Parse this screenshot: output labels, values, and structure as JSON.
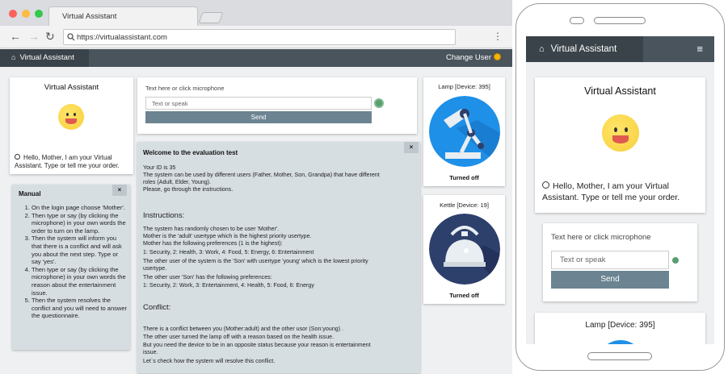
{
  "browser": {
    "tab_title": "Virtual Assistant",
    "url": "https://virtualassistant.com"
  },
  "nav": {
    "brand": "Virtual Assistant",
    "change_user": "Change User"
  },
  "assistant": {
    "title": "Virtual Assistant",
    "greeting": "Hello, Mother, I am your Virtual Assistant. Type or tell me your order.",
    "greeting_line1": "Hello, Mother, I am your Virtual",
    "greeting_line2": "Assistant. Type or tell me your order."
  },
  "input": {
    "label": "Text here or click microphone",
    "placeholder": "Text or speak",
    "send_label": "Send"
  },
  "manual": {
    "title": "Manual",
    "close": "×",
    "items": [
      "On the login page choose 'Mother'.",
      "Then type or say (by clicking the microphone) in your own words the order to turn on the lamp.",
      "Then the system will inform you that there is a conflict and will ask you about the next step. Type or say 'yes'.",
      "Then type or say (by clicking the microphone) in your own words the reason about the entertainment issue.",
      "Then the system resolves the conflict and you will need to answer the questionnaire."
    ]
  },
  "welcome": {
    "title": "Welcome to the evaluation test",
    "close": "×",
    "id_line": "Your ID is 35",
    "intro_1": "The system can be used by different users (Father, Mother, Son, Grandpa) that have different",
    "intro_2": "roles (Adult, Elder, Young).",
    "intro_3": "Please, go through the instructions.",
    "instructions_heading": "Instructions:",
    "instr_1": "The system has randomly chosen to be user 'Mother'.",
    "instr_2": "Mother is the 'adult' usertype which is the highest priority usertype.",
    "instr_3": "Mother has the following preferences (1 is the highest):",
    "instr_4": "1: Security, 2: Health, 3: Work, 4: Food, 5: Energy, 6: Entertainment",
    "instr_5": "The other user of the system is the 'Son' with usertype 'young' which is the lowest priority",
    "instr_6": "usertype.",
    "instr_7": "The other user 'Son' has the following preferences:",
    "instr_8": "1: Security, 2: Work, 3: Entertainment, 4: Health, 5: Food, 6: Energy",
    "conflict_heading": "Conflict:",
    "conf_1": "There is a conflict between you (Mother:adult) and the other usor (Son:young) .",
    "conf_2": "The other user turned the lamp off with a reason based on the health issue.",
    "conf_3": "But you need the device to be in an opposite status because your reason is entertainment",
    "conf_4": "issue.",
    "conf_5": "Let`s check how the system will resolve this conflict."
  },
  "devices": {
    "lamp": {
      "title": "Lamp [Device: 395]",
      "status": "Turned off",
      "icon": "desk-lamp-icon"
    },
    "kettle": {
      "title": "Kettle [Device: 19]",
      "status": "Turned off",
      "icon": "kettle-icon"
    }
  },
  "phone": {
    "brand": "Virtual Assistant",
    "assistant_title": "Virtual Assistant",
    "greeting_line1": "Hello, Mother, I am your Virtual",
    "greeting_line2": "Assistant. Type or tell me your order.",
    "input_label": "Text here or click microphone",
    "input_placeholder": "Text or speak",
    "send_label": "Send",
    "lamp_title": "Lamp [Device: 395]"
  },
  "colors": {
    "nav_bg": "#4a545c",
    "brand_bg": "#3a4349",
    "panel_bg": "#d7dee2",
    "send_button": "#6c8491",
    "device_blue": "#1e90e8",
    "kettle_navy": "#2d3f6b"
  }
}
